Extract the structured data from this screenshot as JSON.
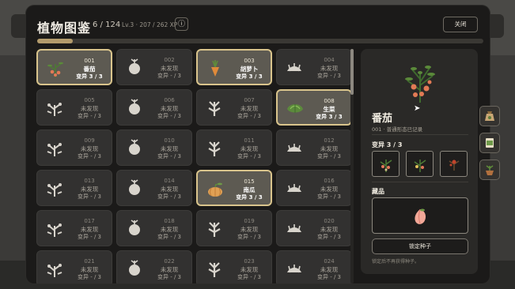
{
  "modal": {
    "title": "植物图鉴",
    "count": "6 / 124",
    "level_xp": "Lv.3 · 207 / 262 XP",
    "info_label": "ⓘ",
    "close_label": "关闭",
    "xp_progress": 0.079
  },
  "cards": [
    {
      "num": "001",
      "name": "番茄",
      "mutation": "变异 3 / 3",
      "found": true,
      "icon": "tomato-plant-icon"
    },
    {
      "num": "002",
      "name": "未发现",
      "mutation": "变异 - / 3",
      "found": false,
      "icon": "plant-silhouette-icon"
    },
    {
      "num": "003",
      "name": "胡萝卜",
      "mutation": "变异 3 / 3",
      "found": true,
      "icon": "carrot-icon"
    },
    {
      "num": "004",
      "name": "未发现",
      "mutation": "变异 - / 3",
      "found": false,
      "icon": "plant-silhouette-icon"
    },
    {
      "num": "005",
      "name": "未发现",
      "mutation": "变异 - / 3",
      "found": false,
      "icon": "plant-silhouette-icon"
    },
    {
      "num": "006",
      "name": "未发现",
      "mutation": "变异 - / 3",
      "found": false,
      "icon": "plant-silhouette-icon"
    },
    {
      "num": "007",
      "name": "未发现",
      "mutation": "变异 - / 3",
      "found": false,
      "icon": "plant-silhouette-icon"
    },
    {
      "num": "008",
      "name": "生菜",
      "mutation": "变异 3 / 3",
      "found": true,
      "icon": "lettuce-icon"
    },
    {
      "num": "009",
      "name": "未发现",
      "mutation": "变异 - / 3",
      "found": false,
      "icon": "plant-silhouette-icon"
    },
    {
      "num": "010",
      "name": "未发现",
      "mutation": "变异 - / 3",
      "found": false,
      "icon": "plant-silhouette-icon"
    },
    {
      "num": "011",
      "name": "未发现",
      "mutation": "变异 - / 3",
      "found": false,
      "icon": "plant-silhouette-icon"
    },
    {
      "num": "012",
      "name": "未发现",
      "mutation": "变异 - / 3",
      "found": false,
      "icon": "plant-silhouette-icon"
    },
    {
      "num": "013",
      "name": "未发现",
      "mutation": "变异 - / 3",
      "found": false,
      "icon": "plant-silhouette-icon"
    },
    {
      "num": "014",
      "name": "未发现",
      "mutation": "变异 - / 3",
      "found": false,
      "icon": "plant-silhouette-icon"
    },
    {
      "num": "015",
      "name": "南瓜",
      "mutation": "变异 3 / 3",
      "found": true,
      "icon": "pumpkin-icon"
    },
    {
      "num": "016",
      "name": "未发现",
      "mutation": "变异 - / 3",
      "found": false,
      "icon": "plant-silhouette-icon"
    },
    {
      "num": "017",
      "name": "未发现",
      "mutation": "变异 - / 3",
      "found": false,
      "icon": "plant-silhouette-icon"
    },
    {
      "num": "018",
      "name": "未发现",
      "mutation": "变异 - / 3",
      "found": false,
      "icon": "plant-silhouette-icon"
    },
    {
      "num": "019",
      "name": "未发现",
      "mutation": "变异 - / 3",
      "found": false,
      "icon": "plant-silhouette-icon"
    },
    {
      "num": "020",
      "name": "未发现",
      "mutation": "变异 - / 3",
      "found": false,
      "icon": "plant-silhouette-icon"
    },
    {
      "num": "021",
      "name": "未发现",
      "mutation": "变异 - / 3",
      "found": false,
      "icon": "plant-silhouette-icon"
    },
    {
      "num": "022",
      "name": "未发现",
      "mutation": "变异 - / 3",
      "found": false,
      "icon": "plant-silhouette-icon"
    },
    {
      "num": "023",
      "name": "未发现",
      "mutation": "变异 - / 3",
      "found": false,
      "icon": "plant-silhouette-icon"
    },
    {
      "num": "024",
      "name": "未发现",
      "mutation": "变异 - / 3",
      "found": false,
      "icon": "plant-silhouette-icon"
    }
  ],
  "detail": {
    "name": "番茄",
    "subtitle": "001 · 普通形态已记录",
    "mutation_heading": "变异  3 / 3",
    "product_heading": "藏品",
    "seed_button": "锁定种子",
    "hint": "锁定后不再获得种子。"
  },
  "colors": {
    "accent_gold": "#d9c48c",
    "found_card_bg": "#5d5a52",
    "xp_fill": "#b39b6c"
  },
  "side_buttons": [
    "seed-bag-icon",
    "seed-packet-icon",
    "potted-plant-icon"
  ]
}
